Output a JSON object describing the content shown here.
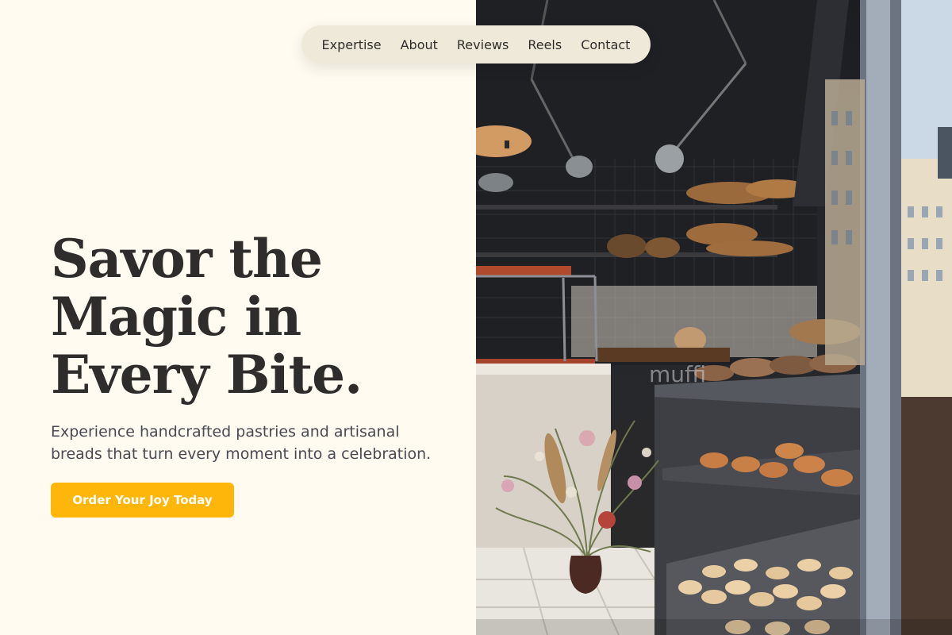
{
  "nav": {
    "items": [
      {
        "label": "Expertise"
      },
      {
        "label": "About"
      },
      {
        "label": "Reviews"
      },
      {
        "label": "Reels"
      },
      {
        "label": "Contact"
      }
    ]
  },
  "hero": {
    "title_line1": "Savor the",
    "title_line2": "Magic in",
    "title_line3": "Every Bite.",
    "subtitle": "Experience handcrafted pastries and artisanal breads that turn every moment into a celebration.",
    "cta_label": "Order Your Joy Today"
  },
  "photo": {
    "window_text": "muffi"
  },
  "colors": {
    "background": "#fffbf0",
    "nav_bg": "#efe9da",
    "accent": "#fdb609",
    "heading": "#2f2d2b",
    "body_text": "#4a4a52"
  }
}
